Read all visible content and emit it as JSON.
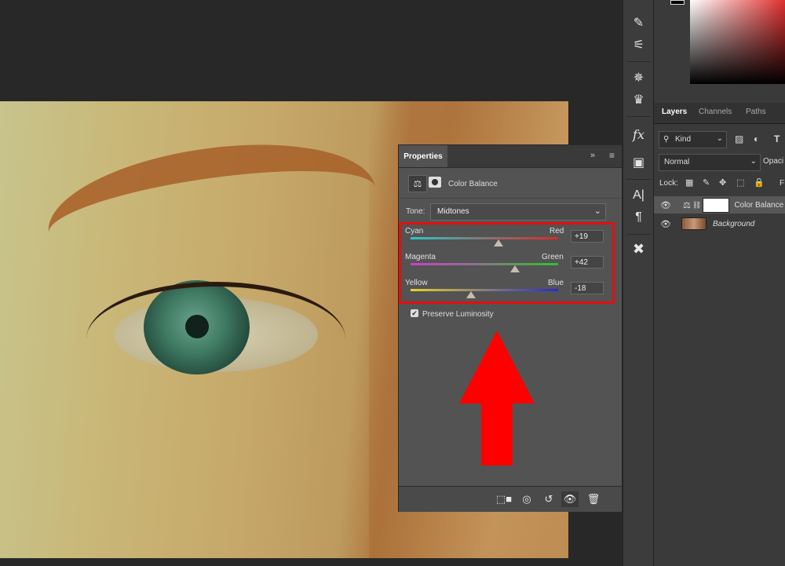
{
  "properties": {
    "tab_label": "Properties",
    "adjustment_name": "Color Balance",
    "tone_label": "Tone:",
    "tone_value": "Midtones",
    "sliders": [
      {
        "left": "Cyan",
        "right": "Red",
        "value": "+19",
        "level": 0.595
      },
      {
        "left": "Magenta",
        "right": "Green",
        "value": "+42",
        "level": 0.71
      },
      {
        "left": "Yellow",
        "right": "Blue",
        "value": "-18",
        "level": 0.41
      }
    ],
    "preserve_luminosity": "Preserve Luminosity"
  },
  "layers_panel": {
    "tabs": [
      "Layers",
      "Channels",
      "Paths"
    ],
    "kind": "Kind",
    "blend_mode": "Normal",
    "opacity_label": "Opaci",
    "lock_label": "Lock:",
    "fill_label": "F",
    "layers": [
      {
        "name": "Color Balance"
      },
      {
        "name": "Background"
      }
    ]
  },
  "colors": {
    "annotation_red": "#e01010",
    "panel_bg": "#535353",
    "dock_bg": "#3a3a3a"
  }
}
